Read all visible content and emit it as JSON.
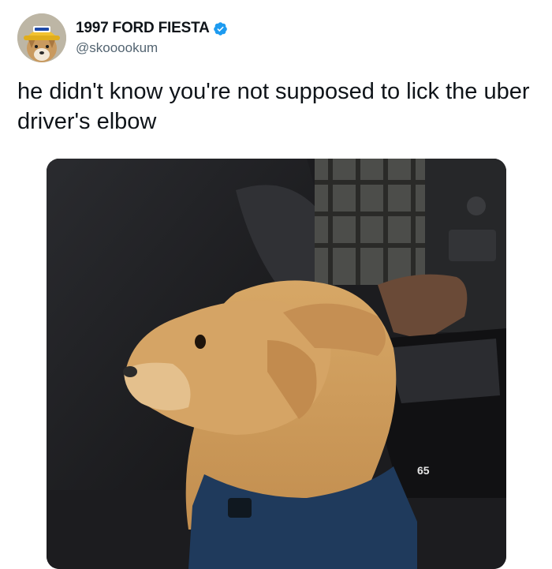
{
  "tweet": {
    "display_name": "1997 FORD FIESTA",
    "handle": "@skooookum",
    "text": "he didn't know you're not supposed to lick the uber driver's elbow",
    "verified": true,
    "avatar_icon": "dog-with-hat-avatar",
    "media": {
      "subject": "dog sitting in car back seat beside driver",
      "overlay_text": "65"
    }
  },
  "colors": {
    "verified": "#1d9bf0",
    "handle": "#536471",
    "text": "#0f1419"
  }
}
